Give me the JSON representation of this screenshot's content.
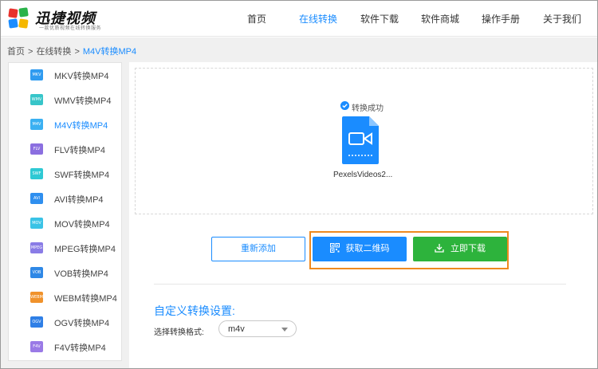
{
  "header": {
    "brand": "迅捷视频",
    "slogan": "一款优质视频在线转换服务",
    "nav": [
      {
        "label": "首页"
      },
      {
        "label": "在线转换",
        "active": true
      },
      {
        "label": "软件下载"
      },
      {
        "label": "软件商城"
      },
      {
        "label": "操作手册"
      },
      {
        "label": "关于我们"
      }
    ]
  },
  "breadcrumb": {
    "home": "首页",
    "sep1": ">",
    "section": "在线转换",
    "sep2": ">",
    "current": "M4V转换MP4"
  },
  "sidebar": {
    "items": [
      {
        "badge": "MKV",
        "label": "MKV转换MP4",
        "color": "#2f9bf0"
      },
      {
        "badge": "WMV",
        "label": "WMV转换MP4",
        "color": "#37c5c9"
      },
      {
        "badge": "M4V",
        "label": "M4V转换MP4",
        "color": "#3ab0f2",
        "active": true
      },
      {
        "badge": "FLV",
        "label": "FLV转换MP4",
        "color": "#8b6fe0"
      },
      {
        "badge": "SWF",
        "label": "SWF转换MP4",
        "color": "#2ec9d4"
      },
      {
        "badge": "AVI",
        "label": "AVI转换MP4",
        "color": "#2f8fef"
      },
      {
        "badge": "MOV",
        "label": "MOV转换MP4",
        "color": "#3ac3e6"
      },
      {
        "badge": "MPEG",
        "label": "MPEG转换MP4",
        "color": "#8a7ce6"
      },
      {
        "badge": "VOB",
        "label": "VOB转换MP4",
        "color": "#2f88e6"
      },
      {
        "badge": "WEBM",
        "label": "WEBM转换MP4",
        "color": "#f0922b"
      },
      {
        "badge": "OGV",
        "label": "OGV转换MP4",
        "color": "#2f7fe6"
      },
      {
        "badge": "F4V",
        "label": "F4V转换MP4",
        "color": "#9a7ae6"
      }
    ]
  },
  "main": {
    "status_text": "转换成功",
    "file_name": "PexelsVideos2...",
    "buttons": {
      "re_add": "重新添加",
      "qr": "获取二维码",
      "download": "立即下载"
    },
    "settings_title": "自定义转换设置:",
    "format_label": "选择转换格式:",
    "format_value": "m4v"
  },
  "colors": {
    "accent": "#1a8cff",
    "download_green": "#2db33c",
    "highlight_orange": "#ef8a1f"
  }
}
